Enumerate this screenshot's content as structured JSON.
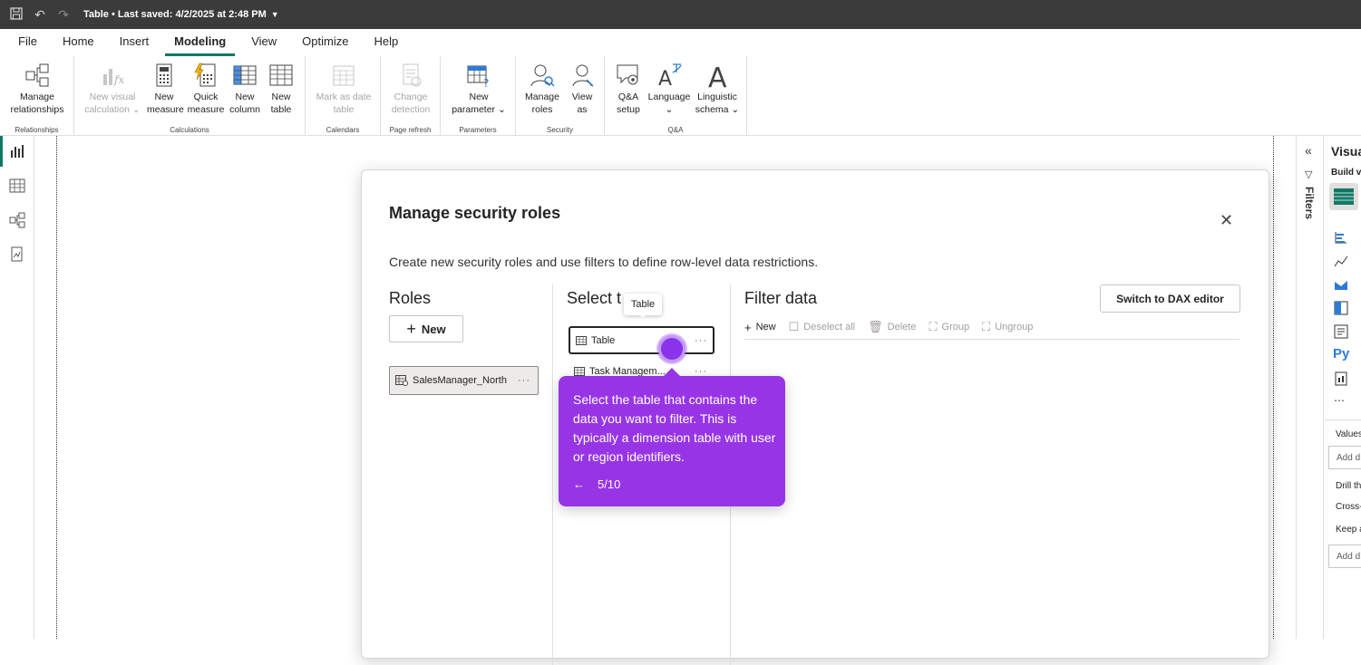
{
  "titlebar": {
    "title": "Table • Last saved: 4/2/2025 at 2:48 PM"
  },
  "menu": [
    "File",
    "Home",
    "Insert",
    "Modeling",
    "View",
    "Optimize",
    "Help"
  ],
  "menu_active": "Modeling",
  "ribbon": {
    "groups": [
      {
        "label": "Relationships",
        "buttons": [
          {
            "l1": "Manage",
            "l2": "relationships"
          }
        ]
      },
      {
        "label": "Calculations",
        "buttons": [
          {
            "l1": "New visual",
            "l2": "calculation ⌄"
          },
          {
            "l1": "New",
            "l2": "measure"
          },
          {
            "l1": "Quick",
            "l2": "measure"
          },
          {
            "l1": "New",
            "l2": "column"
          },
          {
            "l1": "New",
            "l2": "table"
          }
        ]
      },
      {
        "label": "Calendars",
        "buttons": [
          {
            "l1": "Mark as date",
            "l2": "table"
          }
        ]
      },
      {
        "label": "Page refresh",
        "buttons": [
          {
            "l1": "Change",
            "l2": "detection"
          }
        ]
      },
      {
        "label": "Parameters",
        "buttons": [
          {
            "l1": "New",
            "l2": "parameter ⌄"
          }
        ]
      },
      {
        "label": "Security",
        "buttons": [
          {
            "l1": "Manage",
            "l2": "roles"
          },
          {
            "l1": "View",
            "l2": "as"
          }
        ]
      },
      {
        "label": "Q&A",
        "buttons": [
          {
            "l1": "Q&A",
            "l2": "setup"
          },
          {
            "l1": "Language",
            "l2": "⌄"
          },
          {
            "l1": "Linguistic",
            "l2": "schema ⌄"
          }
        ]
      }
    ]
  },
  "right_panel": {
    "filters_label": "Filters",
    "vis_title": "Visua",
    "build": "Build v",
    "values": "Values",
    "add1": "Add d",
    "drill": "Drill th",
    "cross": "Cross-",
    "keep": "Keep a",
    "add2": "Add d",
    "py": "Py"
  },
  "dialog": {
    "title": "Manage security roles",
    "description": "Create new security roles and use filters to define row-level data restrictions.",
    "roles_heading": "Roles",
    "new_label": "New",
    "role_name": "SalesManager_North",
    "select_table_heading": "Select t",
    "select_table_heading_end": "",
    "tables": [
      "Table",
      "Task Managem..."
    ],
    "tooltip": "Table",
    "filter_heading": "Filter data",
    "dax_button": "Switch to DAX editor",
    "toolbar": [
      "New",
      "Deselect all",
      "Delete",
      "Group",
      "Ungroup"
    ]
  },
  "tour": {
    "text": "Select the table that contains the data you want to filter. This is typically a dimension table with user or region identifiers.",
    "back": "←",
    "step": "5/10"
  },
  "colors": {
    "accent": "#117865",
    "tour": "#9735e6",
    "titlebar": "#3b3b3b"
  }
}
